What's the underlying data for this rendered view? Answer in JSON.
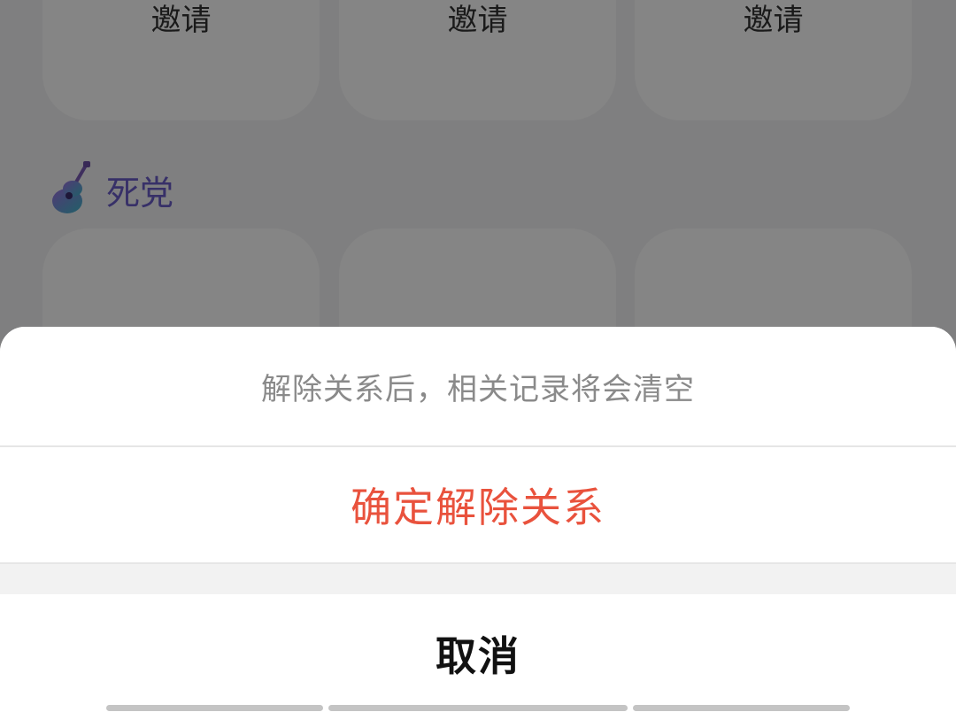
{
  "background": {
    "cards_top": [
      {
        "label": "邀请"
      },
      {
        "label": "邀请"
      },
      {
        "label": "邀请"
      }
    ],
    "section": {
      "title": "死党",
      "icon": "guitar-icon"
    }
  },
  "sheet": {
    "message": "解除关系后，相关记录将会清空",
    "confirm_label": "确定解除关系",
    "cancel_label": "取消"
  },
  "colors": {
    "confirm": "#e9523d",
    "section_title": "#6a5cc7",
    "scrim": "rgba(0,0,0,0.48)"
  }
}
